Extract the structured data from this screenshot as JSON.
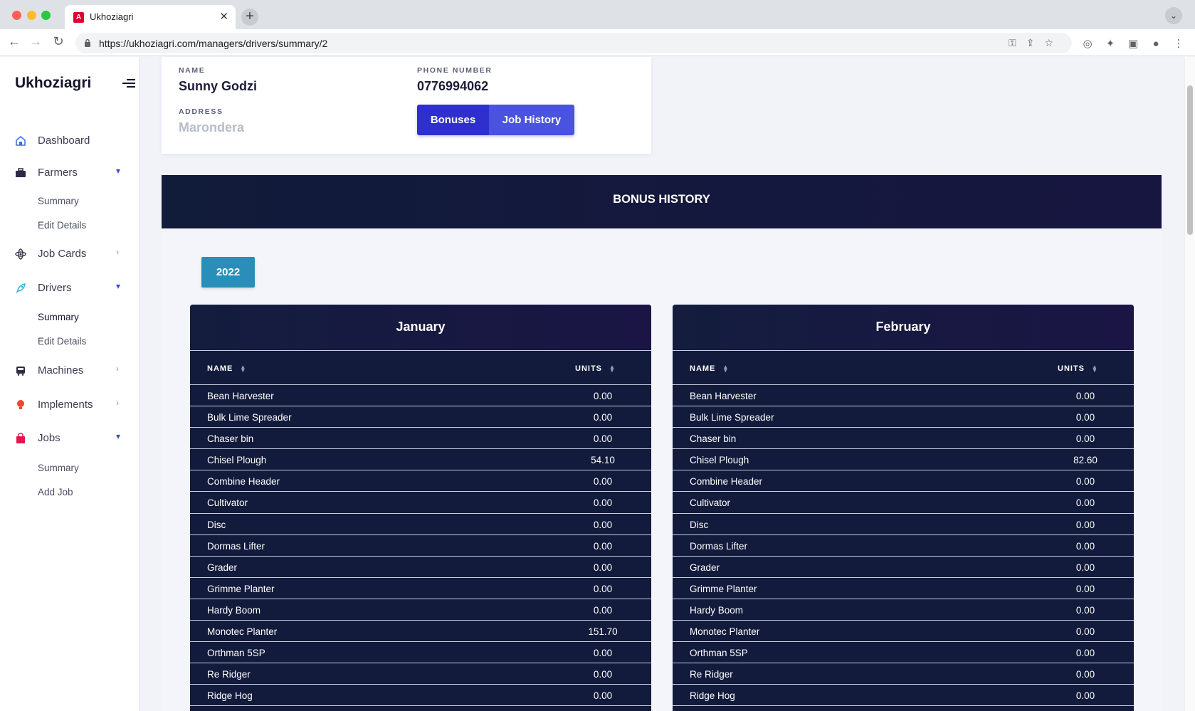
{
  "browser": {
    "tab_title": "Ukhoziagri",
    "url": "https://ukhoziagri.com/managers/drivers/summary/2"
  },
  "sidebar": {
    "brand": "Ukhoziagri",
    "items": [
      {
        "label": "Dashboard",
        "icon": "home-icon"
      },
      {
        "label": "Farmers",
        "icon": "briefcase-icon",
        "expanded": true,
        "children": [
          "Summary",
          "Edit Details"
        ]
      },
      {
        "label": "Job Cards",
        "icon": "atom-icon"
      },
      {
        "label": "Drivers",
        "icon": "rocket-icon",
        "expanded": true,
        "children": [
          "Summary",
          "Edit Details"
        ]
      },
      {
        "label": "Machines",
        "icon": "bus-icon"
      },
      {
        "label": "Implements",
        "icon": "bulb-icon"
      },
      {
        "label": "Jobs",
        "icon": "bag-icon",
        "expanded": true,
        "children": [
          "Summary",
          "Add Job"
        ]
      }
    ]
  },
  "profile": {
    "name_label": "NAME",
    "name": "Sunny Godzi",
    "phone_label": "PHONE NUMBER",
    "phone": "0776994062",
    "address_label": "ADDRESS",
    "address": "Marondera",
    "bonuses_button": "Bonuses",
    "job_history_button": "Job History"
  },
  "bonus": {
    "title": "BONUS HISTORY",
    "year": "2022",
    "col_name": "NAME",
    "col_units": "UNITS",
    "months": [
      {
        "month": "January",
        "rows": [
          {
            "name": "Bean Harvester",
            "units": "0.00"
          },
          {
            "name": "Bulk Lime Spreader",
            "units": "0.00"
          },
          {
            "name": "Chaser bin",
            "units": "0.00"
          },
          {
            "name": "Chisel Plough",
            "units": "54.10"
          },
          {
            "name": "Combine Header",
            "units": "0.00"
          },
          {
            "name": "Cultivator",
            "units": "0.00"
          },
          {
            "name": "Disc",
            "units": "0.00"
          },
          {
            "name": "Dormas Lifter",
            "units": "0.00"
          },
          {
            "name": "Grader",
            "units": "0.00"
          },
          {
            "name": "Grimme Planter",
            "units": "0.00"
          },
          {
            "name": "Hardy Boom",
            "units": "0.00"
          },
          {
            "name": "Monotec Planter",
            "units": "151.70"
          },
          {
            "name": "Orthman 5SP",
            "units": "0.00"
          },
          {
            "name": "Re Ridger",
            "units": "0.00"
          },
          {
            "name": "Ridge Hog",
            "units": "0.00"
          }
        ]
      },
      {
        "month": "February",
        "rows": [
          {
            "name": "Bean Harvester",
            "units": "0.00"
          },
          {
            "name": "Bulk Lime Spreader",
            "units": "0.00"
          },
          {
            "name": "Chaser bin",
            "units": "0.00"
          },
          {
            "name": "Chisel Plough",
            "units": "82.60"
          },
          {
            "name": "Combine Header",
            "units": "0.00"
          },
          {
            "name": "Cultivator",
            "units": "0.00"
          },
          {
            "name": "Disc",
            "units": "0.00"
          },
          {
            "name": "Dormas Lifter",
            "units": "0.00"
          },
          {
            "name": "Grader",
            "units": "0.00"
          },
          {
            "name": "Grimme Planter",
            "units": "0.00"
          },
          {
            "name": "Hardy Boom",
            "units": "0.00"
          },
          {
            "name": "Monotec Planter",
            "units": "0.00"
          },
          {
            "name": "Orthman 5SP",
            "units": "0.00"
          },
          {
            "name": "Re Ridger",
            "units": "0.00"
          },
          {
            "name": "Ridge Hog",
            "units": "0.00"
          }
        ]
      }
    ]
  },
  "colors": {
    "navy": "#121b3b",
    "primary": "#2f2fce",
    "year_button": "#2a8fb8"
  }
}
